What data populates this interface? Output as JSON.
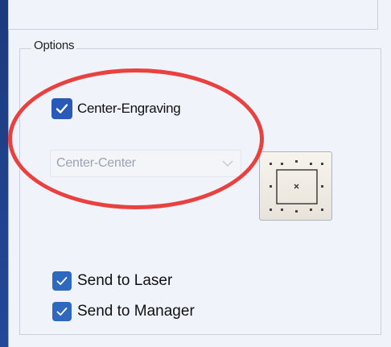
{
  "options": {
    "group_title": "Options",
    "center_engraving": {
      "label": "Center-Engraving",
      "checked": true
    },
    "alignment_select": {
      "value": "Center-Center",
      "enabled": false
    },
    "alignment_button_icon": "center-position-icon",
    "send_to_laser": {
      "label": "Send to Laser",
      "checked": true
    },
    "send_to_manager": {
      "label": "Send to Manager",
      "checked": true
    }
  },
  "colors": {
    "checkbox_blue": "#2f68bf",
    "highlight_ellipse": "#e8413f",
    "window_frame": "#1d3f86"
  }
}
